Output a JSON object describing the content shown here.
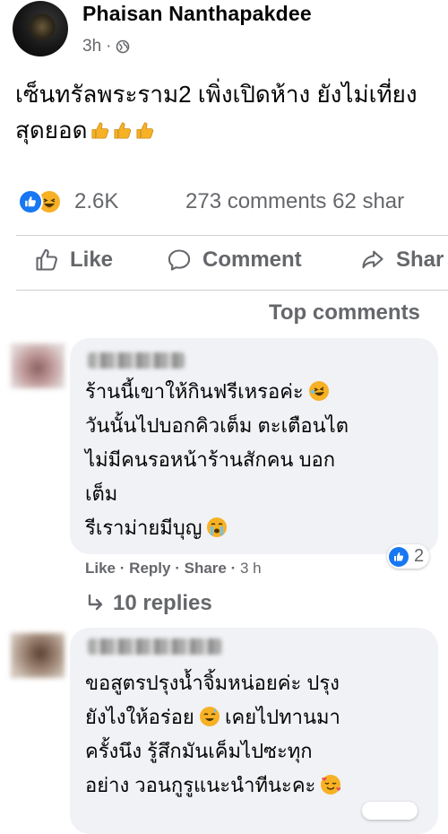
{
  "post": {
    "author": "Phaisan Nanthapakdee",
    "time": "3h",
    "privacy_icon": "globe-icon",
    "text_line1": "เซ็นทรัลพระราม2 เพิ่งเปิดห้าง ยังไม่เที่ยง",
    "text_line2": "สุดยอด",
    "text_emoji": [
      "thumbs-up-icon",
      "thumbs-up-icon",
      "thumbs-up-icon"
    ]
  },
  "stats": {
    "reaction_icons": [
      "like-icon",
      "haha-icon"
    ],
    "reactions": "2.6K",
    "comments": "273 comments",
    "shares": "62 shar"
  },
  "actions": {
    "like": "Like",
    "comment": "Comment",
    "share": "Shar"
  },
  "filter_label": "Top comments",
  "comments": [
    {
      "lines": [
        "ร้านนี้เขาให้กินฟรีเหรอค่ะ",
        "วันนั้นไปบอกคิวเต็ม ตะเตือนไต",
        "ไม่มีคนรอหน้าร้านสักคน บอก",
        "เต็ม",
        "รีเราม่ายมีบุญ"
      ],
      "emoji": [
        "rolling-laugh-icon",
        "crying-icon"
      ],
      "like_label": "Like",
      "reply_label": "Reply",
      "share_label": "Share",
      "time": "3 h",
      "sep": "·",
      "reaction_count": "2",
      "replies": "10 replies"
    },
    {
      "lines": [
        "ขอสูตรปรุงน้ำจิ้มหน่อยค่ะ ปรุง",
        "ยังไงให้อร่อย",
        "เคยไปทานมา",
        "ครั้งนึง รู้สึกมันเค็มไปซะทุก",
        "อย่าง วอนกูรูแนะนำทีนะคะ"
      ],
      "emoji": [
        "sweat-smile-icon",
        "smiling-hearts-icon"
      ]
    }
  ],
  "colors": {
    "brand_blue": "#1877f2",
    "secondary_text": "#65676b",
    "bubble_bg": "#f0f2f5",
    "divider": "#ced0d4",
    "emoji_yellow": "#f7b125"
  }
}
